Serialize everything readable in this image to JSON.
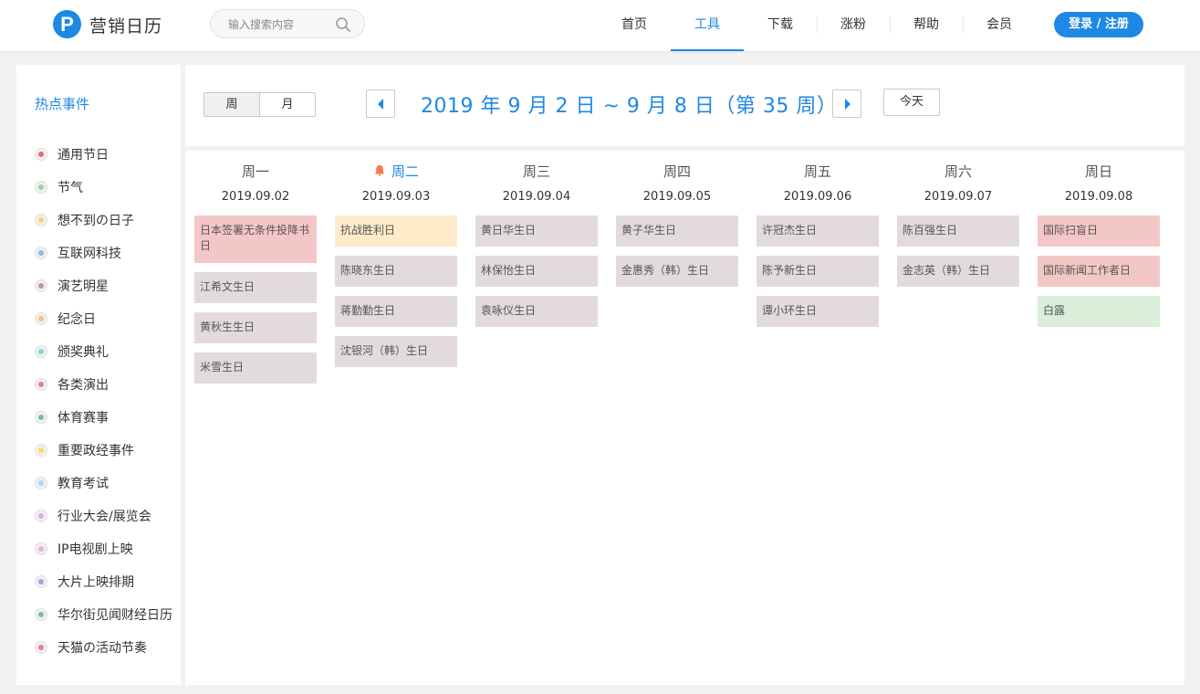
{
  "header": {
    "logo_mark": "P",
    "logo_text": "营销日历",
    "search_placeholder": "输入搜索内容",
    "nav": [
      "首页",
      "工具",
      "下载",
      "涨粉",
      "帮助",
      "会员"
    ],
    "active_nav": "工具",
    "login_label": "登录 / 注册"
  },
  "sidebar": {
    "title": "热点事件",
    "categories": [
      {
        "label": "通用节日",
        "color": "#e06c75"
      },
      {
        "label": "节气",
        "color": "#9ed29e"
      },
      {
        "label": "想不到の日子",
        "color": "#f6d66a"
      },
      {
        "label": "互联网科技",
        "color": "#7ec0ef"
      },
      {
        "label": "演艺明星",
        "color": "#b89a8e"
      },
      {
        "label": "纪念日",
        "color": "#f6c56a"
      },
      {
        "label": "颁奖典礼",
        "color": "#7fd7e6"
      },
      {
        "label": "各类演出",
        "color": "#ec7a9a"
      },
      {
        "label": "体育赛事",
        "color": "#6cc2a8"
      },
      {
        "label": "重要政经事件",
        "color": "#f7e063"
      },
      {
        "label": "教育考试",
        "color": "#a6dcf0"
      },
      {
        "label": "行业大会/展览会",
        "color": "#d6b0e0"
      },
      {
        "label": "IP电视剧上映",
        "color": "#e6b1e6"
      },
      {
        "label": "大片上映排期",
        "color": "#9aa6dc"
      },
      {
        "label": "华尔街见闻财经日历",
        "color": "#6cc2a8"
      },
      {
        "label": "天猫の活动节奏",
        "color": "#ec7a9a"
      }
    ]
  },
  "toolbar": {
    "view_week": "周",
    "view_month": "月",
    "date_range": "2019 年 9 月 2 日 ~ 9 月 8 日（第 35 周）",
    "today_label": "今天"
  },
  "calendar": {
    "days": [
      {
        "name": "周一",
        "date": "2019.09.02",
        "events": [
          {
            "text": "日本签署无条件投降书日",
            "type": "pink"
          },
          {
            "text": "江希文生日",
            "type": "gray"
          },
          {
            "text": "黄秋生生日",
            "type": "gray"
          },
          {
            "text": "米雪生日",
            "type": "gray"
          }
        ]
      },
      {
        "name": "周二",
        "date": "2019.09.03",
        "today": true,
        "events": [
          {
            "text": "抗战胜利日",
            "type": "yellow"
          },
          {
            "text": "陈晓东生日",
            "type": "gray"
          },
          {
            "text": "蒋勤勤生日",
            "type": "gray"
          },
          {
            "text": "沈银河（韩）生日",
            "type": "gray"
          }
        ]
      },
      {
        "name": "周三",
        "date": "2019.09.04",
        "events": [
          {
            "text": "黄日华生日",
            "type": "gray"
          },
          {
            "text": "林保怡生日",
            "type": "gray"
          },
          {
            "text": "袁咏仪生日",
            "type": "gray"
          }
        ]
      },
      {
        "name": "周四",
        "date": "2019.09.05",
        "events": [
          {
            "text": "黄子华生日",
            "type": "gray"
          },
          {
            "text": "金惠秀（韩）生日",
            "type": "gray"
          }
        ]
      },
      {
        "name": "周五",
        "date": "2019.09.06",
        "events": [
          {
            "text": "许冠杰生日",
            "type": "gray"
          },
          {
            "text": "陈予新生日",
            "type": "gray"
          },
          {
            "text": "谭小环生日",
            "type": "gray"
          }
        ]
      },
      {
        "name": "周六",
        "date": "2019.09.07",
        "events": [
          {
            "text": "陈百强生日",
            "type": "gray"
          },
          {
            "text": "金志英（韩）生日",
            "type": "gray"
          }
        ]
      },
      {
        "name": "周日",
        "date": "2019.09.08",
        "events": [
          {
            "text": "国际扫盲日",
            "type": "pink"
          },
          {
            "text": "国际新闻工作者日",
            "type": "pink"
          },
          {
            "text": "白露",
            "type": "green"
          }
        ]
      }
    ]
  }
}
